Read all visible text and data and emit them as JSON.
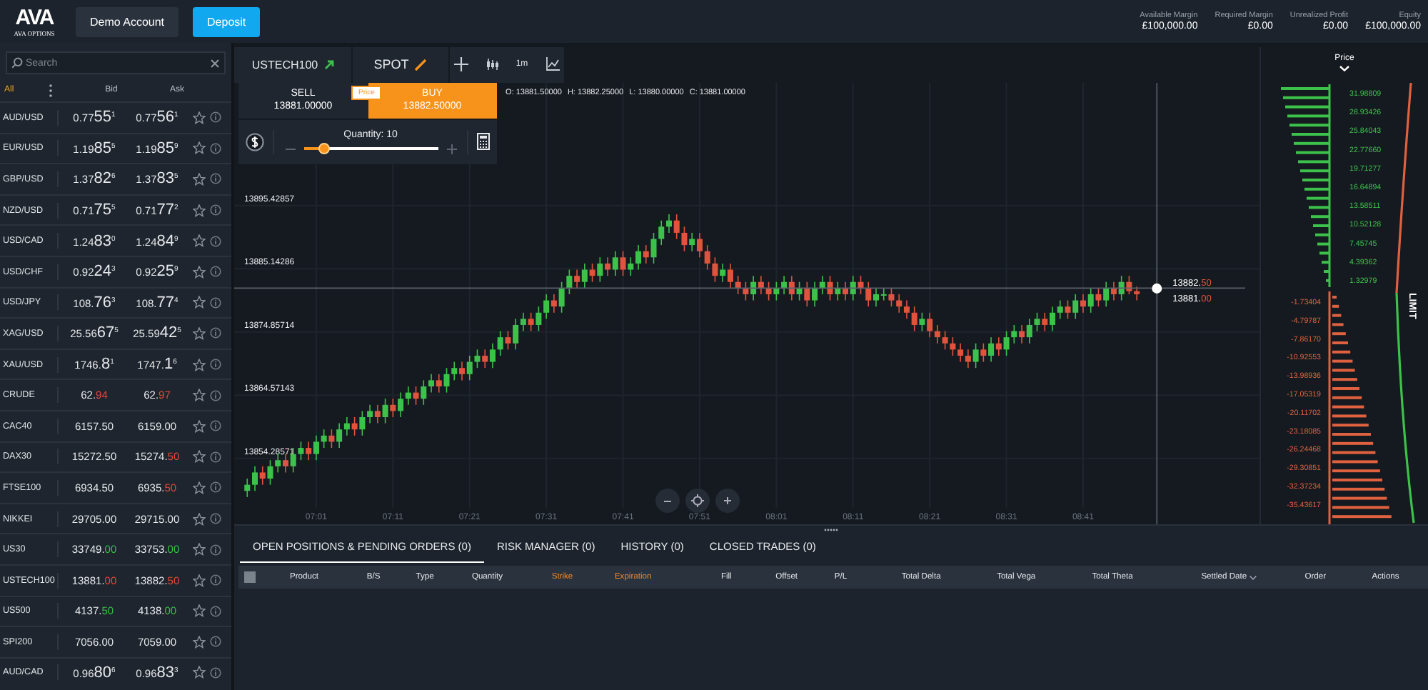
{
  "header": {
    "logo_text": "AVA",
    "logo_subtext": "AVA OPTIONS",
    "buttons": [
      {
        "label": "Demo Account",
        "kind": "secondary"
      },
      {
        "label": "Deposit",
        "kind": "primary"
      }
    ],
    "metrics": [
      {
        "label": "Available Margin",
        "value": "£100,000.00"
      },
      {
        "label": "Required Margin",
        "value": "£0.00"
      },
      {
        "label": "Unrealized Profit",
        "value": "£0.00"
      },
      {
        "label": "Equity",
        "value": "£100,000.00"
      }
    ]
  },
  "watchlist": {
    "search": {
      "placeholder": "Search"
    },
    "filter": "All",
    "bid_heading": "Bid",
    "ask_heading": "Ask",
    "rows": [
      {
        "name": "AUD/USD",
        "bid": {
          "lead": "0.77",
          "pips": "55",
          "sup": "1",
          "kind": "fx"
        },
        "ask": {
          "lead": "0.77",
          "pips": "56",
          "sup": "1",
          "kind": "fx"
        }
      },
      {
        "name": "EUR/USD",
        "bid": {
          "lead": "1.19",
          "pips": "85",
          "sup": "5",
          "kind": "fx"
        },
        "ask": {
          "lead": "1.19",
          "pips": "85",
          "sup": "9",
          "kind": "fx"
        }
      },
      {
        "name": "GBP/USD",
        "bid": {
          "lead": "1.37",
          "pips": "82",
          "sup": "6",
          "kind": "fx"
        },
        "ask": {
          "lead": "1.37",
          "pips": "83",
          "sup": "5",
          "kind": "fx"
        }
      },
      {
        "name": "NZD/USD",
        "bid": {
          "lead": "0.71",
          "pips": "75",
          "sup": "5",
          "kind": "fx"
        },
        "ask": {
          "lead": "0.71",
          "pips": "77",
          "sup": "2",
          "kind": "fx"
        }
      },
      {
        "name": "USD/CAD",
        "bid": {
          "lead": "1.24",
          "pips": "83",
          "sup": "0",
          "kind": "fx"
        },
        "ask": {
          "lead": "1.24",
          "pips": "84",
          "sup": "9",
          "kind": "fx"
        }
      },
      {
        "name": "USD/CHF",
        "bid": {
          "lead": "0.92",
          "pips": "24",
          "sup": "3",
          "kind": "fx"
        },
        "ask": {
          "lead": "0.92",
          "pips": "25",
          "sup": "9",
          "kind": "fx"
        }
      },
      {
        "name": "USD/JPY",
        "bid": {
          "lead": "108.",
          "pips": "76",
          "sup": "3",
          "kind": "fx"
        },
        "ask": {
          "lead": "108.",
          "pips": "77",
          "sup": "4",
          "kind": "fx"
        }
      },
      {
        "name": "XAG/USD",
        "bid": {
          "lead": "25.56",
          "pips": "67",
          "sup": "5",
          "kind": "fx"
        },
        "ask": {
          "lead": "25.59",
          "pips": "42",
          "sup": "5",
          "kind": "fx"
        }
      },
      {
        "name": "XAU/USD",
        "bid": {
          "lead": "1746.",
          "pips": "8",
          "sup": "1",
          "kind": "fx"
        },
        "ask": {
          "lead": "1747.",
          "pips": "1",
          "sup": "6",
          "kind": "fx"
        }
      },
      {
        "name": "CRUDE",
        "bid": {
          "lead": "62.",
          "pips": "94",
          "kind": "down"
        },
        "ask": {
          "lead": "62.",
          "pips": "97",
          "kind": "down"
        }
      },
      {
        "name": "CAC40",
        "bid": {
          "lead": "6157.50",
          "kind": "plain"
        },
        "ask": {
          "lead": "6159.00",
          "kind": "plain"
        }
      },
      {
        "name": "DAX30",
        "bid": {
          "lead": "15272.50",
          "kind": "plain"
        },
        "ask": {
          "lead": "15274.",
          "pips": "50",
          "kind": "down"
        }
      },
      {
        "name": "FTSE100",
        "bid": {
          "lead": "6934.50",
          "kind": "plain"
        },
        "ask": {
          "lead": "6935.",
          "pips": "50",
          "kind": "down"
        }
      },
      {
        "name": "NIKKEI",
        "bid": {
          "lead": "29705.00",
          "kind": "plain"
        },
        "ask": {
          "lead": "29715.00",
          "kind": "plain"
        }
      },
      {
        "name": "US30",
        "bid": {
          "lead": "33749.",
          "pips": "00",
          "kind": "up"
        },
        "ask": {
          "lead": "33753.",
          "pips": "00",
          "kind": "up"
        }
      },
      {
        "name": "USTECH100",
        "bid": {
          "lead": "13881.",
          "pips": "00",
          "kind": "down"
        },
        "ask": {
          "lead": "13882.",
          "pips": "50",
          "kind": "down"
        }
      },
      {
        "name": "US500",
        "bid": {
          "lead": "4137.",
          "pips": "50",
          "kind": "up"
        },
        "ask": {
          "lead": "4138.",
          "pips": "00",
          "kind": "up"
        }
      },
      {
        "name": "SPI200",
        "bid": {
          "lead": "7056.00",
          "kind": "plain"
        },
        "ask": {
          "lead": "7059.00",
          "kind": "plain"
        }
      },
      {
        "name": "AUD/CAD",
        "bid": {
          "lead": "0.96",
          "pips": "80",
          "sup": "6",
          "kind": "fx"
        },
        "ask": {
          "lead": "0.96",
          "pips": "83",
          "sup": "3",
          "kind": "fx"
        }
      }
    ]
  },
  "chart_panel": {
    "symbol": "USTECH100",
    "mode": "SPOT",
    "interval": "1m",
    "order_ticket": {
      "sell": {
        "label": "SELL",
        "price": "13881.00000",
        "selected": false
      },
      "buy": {
        "label": "BUY",
        "price": "13882.50000",
        "selected": true
      },
      "badge": "Price",
      "quantity_label": "Quantity: 10",
      "quantity": {
        "level": 0.15
      }
    },
    "ohlc": [
      {
        "label": "O:",
        "value": "13881.50000"
      },
      {
        "label": "H:",
        "value": "13882.25000"
      },
      {
        "label": "L:",
        "value": "13880.00000"
      },
      {
        "label": "C:",
        "value": "13881.00000"
      }
    ],
    "chart_data": {
      "type": "candlestick",
      "grid": true,
      "ylim": [
        13843.5,
        13921
      ],
      "ref_lines": [
        {
          "axis": "y",
          "value": 13882
        }
      ],
      "categories": [
        null,
        null,
        null,
        null,
        null,
        null,
        null,
        null,
        null,
        "07:01",
        null,
        null,
        null,
        null,
        null,
        null,
        null,
        null,
        null,
        "07:11",
        null,
        null,
        null,
        null,
        null,
        null,
        null,
        null,
        null,
        "07:21",
        null,
        null,
        null,
        null,
        null,
        null,
        null,
        null,
        null,
        "07:31",
        null,
        null,
        null,
        null,
        null,
        null,
        null,
        null,
        null,
        "07:41",
        null,
        null,
        null,
        null,
        null,
        null,
        null,
        null,
        null,
        "07:51",
        null,
        null,
        null,
        null,
        null,
        null,
        null,
        null,
        null,
        "08:01",
        null,
        null,
        null,
        null,
        null,
        null,
        null,
        null,
        null,
        "08:11",
        null,
        null,
        null,
        null,
        null,
        null,
        null,
        null,
        null,
        "08:21",
        null,
        null,
        null,
        null,
        null,
        null,
        null,
        null,
        null,
        "08:31",
        null,
        null,
        null,
        null,
        null,
        null,
        null,
        null,
        null,
        "08:41",
        null,
        null,
        null,
        null,
        null,
        null,
        null
      ],
      "yticks": [
        {
          "value": 13895.42857,
          "label": "13895.42857"
        },
        {
          "value": 13885.14286,
          "label": "13885.14286"
        },
        {
          "value": 13874.85714,
          "label": "13874.85714"
        },
        {
          "value": 13864.57143,
          "label": "13864.57143"
        },
        {
          "value": 13854.28571,
          "label": "13854.28571"
        }
      ],
      "ohlc": [
        [
          13849,
          13851,
          13848,
          13850
        ],
        [
          13850,
          13853,
          13849,
          13852
        ],
        [
          13852,
          13853,
          13850,
          13851
        ],
        [
          13851,
          13854,
          13850,
          13853
        ],
        [
          13853,
          13855,
          13852,
          13854
        ],
        [
          13854,
          13855,
          13852,
          13853
        ],
        [
          13853,
          13856,
          13852,
          13855
        ],
        [
          13855,
          13857,
          13854,
          13856
        ],
        [
          13856,
          13857,
          13854,
          13855
        ],
        [
          13855,
          13858,
          13854,
          13857
        ],
        [
          13857,
          13859,
          13856,
          13858
        ],
        [
          13858,
          13859,
          13856,
          13857
        ],
        [
          13857,
          13860,
          13856,
          13859
        ],
        [
          13859,
          13861,
          13858,
          13860
        ],
        [
          13860,
          13861,
          13858,
          13859
        ],
        [
          13859,
          13862,
          13858,
          13861
        ],
        [
          13861,
          13863,
          13860,
          13862
        ],
        [
          13862,
          13863,
          13860,
          13861
        ],
        [
          13861,
          13864,
          13860,
          13863
        ],
        [
          13863,
          13864,
          13861,
          13862
        ],
        [
          13862,
          13865,
          13861,
          13864
        ],
        [
          13864,
          13866,
          13863,
          13865
        ],
        [
          13865,
          13866,
          13863,
          13864
        ],
        [
          13864,
          13867,
          13863,
          13866
        ],
        [
          13866,
          13868,
          13865,
          13867
        ],
        [
          13867,
          13868,
          13865,
          13866
        ],
        [
          13866,
          13869,
          13865,
          13868
        ],
        [
          13868,
          13870,
          13867,
          13869
        ],
        [
          13869,
          13870,
          13867,
          13868
        ],
        [
          13868,
          13871,
          13867,
          13870
        ],
        [
          13870,
          13872,
          13869,
          13871
        ],
        [
          13871,
          13872,
          13869,
          13870
        ],
        [
          13870,
          13873,
          13869,
          13872
        ],
        [
          13872,
          13875,
          13871,
          13874
        ],
        [
          13874,
          13875,
          13872,
          13873
        ],
        [
          13873,
          13877,
          13872,
          13876
        ],
        [
          13876,
          13878,
          13875,
          13877
        ],
        [
          13877,
          13878,
          13875,
          13876
        ],
        [
          13876,
          13879,
          13875,
          13878
        ],
        [
          13878,
          13881,
          13877,
          13880
        ],
        [
          13880,
          13881,
          13878,
          13879
        ],
        [
          13879,
          13883,
          13878,
          13882
        ],
        [
          13882,
          13885,
          13881,
          13884
        ],
        [
          13884,
          13885,
          13882,
          13883
        ],
        [
          13883,
          13886,
          13882,
          13885
        ],
        [
          13885,
          13886,
          13883,
          13884
        ],
        [
          13884,
          13887,
          13883,
          13886
        ],
        [
          13886,
          13887,
          13884,
          13885
        ],
        [
          13885,
          13888,
          13884,
          13887
        ],
        [
          13887,
          13888,
          13884,
          13885
        ],
        [
          13885,
          13887,
          13884,
          13886
        ],
        [
          13886,
          13889,
          13885,
          13888
        ],
        [
          13888,
          13889,
          13886,
          13887
        ],
        [
          13887,
          13891,
          13886,
          13890
        ],
        [
          13890,
          13893,
          13889,
          13892
        ],
        [
          13892,
          13894,
          13891,
          13893
        ],
        [
          13893,
          13894,
          13890,
          13891
        ],
        [
          13891,
          13892,
          13888,
          13889
        ],
        [
          13889,
          13891,
          13888,
          13890
        ],
        [
          13890,
          13891,
          13887,
          13888
        ],
        [
          13888,
          13889,
          13885,
          13886
        ],
        [
          13886,
          13887,
          13883,
          13884
        ],
        [
          13884,
          13886,
          13883,
          13885
        ],
        [
          13885,
          13886,
          13882,
          13883
        ],
        [
          13883,
          13884,
          13881,
          13882
        ],
        [
          13882,
          13883,
          13880,
          13881
        ],
        [
          13881,
          13884,
          13880,
          13883
        ],
        [
          13883,
          13884,
          13881,
          13882
        ],
        [
          13882,
          13883,
          13880,
          13881
        ],
        [
          13881,
          13883,
          13880,
          13882
        ],
        [
          13882,
          13884,
          13881,
          13883
        ],
        [
          13883,
          13884,
          13880,
          13881
        ],
        [
          13881,
          13883,
          13880,
          13882
        ],
        [
          13882,
          13883,
          13879,
          13880
        ],
        [
          13880,
          13883,
          13879,
          13882
        ],
        [
          13882,
          13884,
          13881,
          13883
        ],
        [
          13883,
          13884,
          13880,
          13881
        ],
        [
          13881,
          13883,
          13880,
          13882
        ],
        [
          13882,
          13883,
          13880,
          13881
        ],
        [
          13881,
          13884,
          13880,
          13883
        ],
        [
          13883,
          13884,
          13881,
          13882
        ],
        [
          13882,
          13883,
          13879,
          13880
        ],
        [
          13880,
          13882,
          13879,
          13881
        ],
        [
          13881,
          13882,
          13880,
          13881
        ],
        [
          13881,
          13882,
          13879,
          13880
        ],
        [
          13880,
          13881,
          13878,
          13879
        ],
        [
          13879,
          13880,
          13877,
          13878
        ],
        [
          13878,
          13879,
          13875,
          13876
        ],
        [
          13876,
          13878,
          13875,
          13877
        ],
        [
          13877,
          13878,
          13874,
          13875
        ],
        [
          13875,
          13876,
          13873,
          13874
        ],
        [
          13874,
          13875,
          13872,
          13873
        ],
        [
          13873,
          13874,
          13871,
          13872
        ],
        [
          13872,
          13873,
          13870,
          13871
        ],
        [
          13871,
          13872,
          13869,
          13870
        ],
        [
          13870,
          13873,
          13869,
          13872
        ],
        [
          13872,
          13873,
          13870,
          13871
        ],
        [
          13871,
          13874,
          13870,
          13873
        ],
        [
          13873,
          13874,
          13871,
          13872
        ],
        [
          13872,
          13875,
          13871,
          13874
        ],
        [
          13874,
          13876,
          13873,
          13875
        ],
        [
          13875,
          13876,
          13873,
          13874
        ],
        [
          13874,
          13877,
          13873,
          13876
        ],
        [
          13876,
          13878,
          13875,
          13877
        ],
        [
          13877,
          13878,
          13875,
          13876
        ],
        [
          13876,
          13879,
          13875,
          13878
        ],
        [
          13878,
          13880,
          13877,
          13879
        ],
        [
          13879,
          13880,
          13877,
          13878
        ],
        [
          13878,
          13881,
          13877,
          13880
        ],
        [
          13880,
          13881,
          13878,
          13879
        ],
        [
          13879,
          13882,
          13878,
          13881
        ],
        [
          13881,
          13882,
          13879,
          13880
        ],
        [
          13880,
          13883,
          13879,
          13882
        ],
        [
          13882,
          13883,
          13880,
          13881
        ],
        [
          13881,
          13884,
          13880,
          13883
        ],
        [
          13883,
          13884,
          13881,
          13881.5
        ],
        [
          13881.5,
          13882.25,
          13880,
          13881
        ]
      ]
    },
    "price_tags": [
      {
        "lead": "13882.",
        "tail": "50"
      },
      {
        "lead": "13881.",
        "tail": "00"
      }
    ]
  },
  "ladder": {
    "title": "Price",
    "side_label": "LIMIT",
    "upper_levels": [
      "31.98809",
      "28.93426",
      "25.84043",
      "22.77660",
      "19.71277",
      "16.64894",
      "13.58511",
      "10.52128",
      "7.45745",
      "4.39362",
      "1.32979"
    ],
    "lower_levels": [
      "-1.73404",
      "-4.79787",
      "-7.86170",
      "-10.92553",
      "-13.98936",
      "-17.05319",
      "-20.11702",
      "-23.18085",
      "-26.24468",
      "-29.30851",
      "-32.37234",
      "-35.43617"
    ]
  },
  "bottom_panel": {
    "tabs": [
      {
        "label": "OPEN POSITIONS & PENDING ORDERS (0)",
        "selected": true
      },
      {
        "label": "RISK MANAGER (0)",
        "selected": false
      },
      {
        "label": "HISTORY (0)",
        "selected": false
      },
      {
        "label": "CLOSED TRADES (0)",
        "selected": false
      }
    ],
    "select_all": {
      "checked": false
    },
    "columns": [
      {
        "label": "Product",
        "highlight": false
      },
      {
        "label": "B/S",
        "highlight": false
      },
      {
        "label": "Type",
        "highlight": false
      },
      {
        "label": "Quantity",
        "highlight": false
      },
      {
        "label": "Strike",
        "highlight": true
      },
      {
        "label": "Expiration",
        "highlight": true
      },
      {
        "label": "Fill",
        "highlight": false
      },
      {
        "label": "Offset",
        "highlight": false
      },
      {
        "label": "P/L",
        "highlight": false
      },
      {
        "label": "Total Delta",
        "highlight": false
      },
      {
        "label": "Total Vega",
        "highlight": false
      },
      {
        "label": "Total Theta",
        "highlight": false
      },
      {
        "label": "Settled Date",
        "highlight": false,
        "sortable": true
      },
      {
        "label": "Order",
        "highlight": false
      },
      {
        "label": "Actions",
        "highlight": false
      }
    ]
  }
}
